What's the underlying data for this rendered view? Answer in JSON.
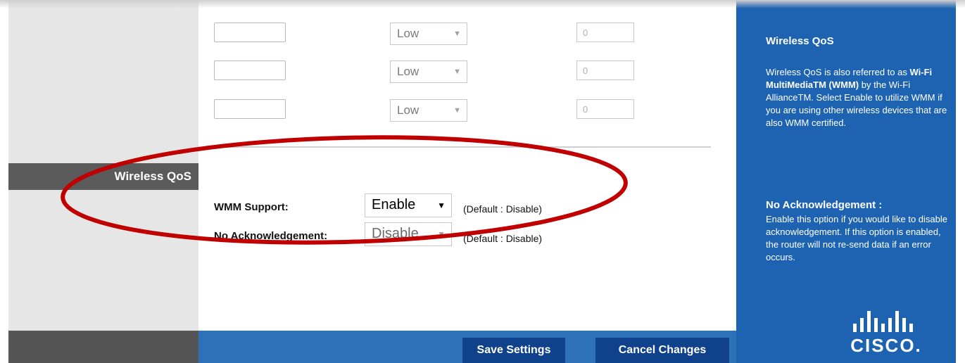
{
  "priority_rows": [
    {
      "port_value": "",
      "priority": "Low",
      "number": "0"
    },
    {
      "port_value": "",
      "priority": "Low",
      "number": "0"
    },
    {
      "port_value": "",
      "priority": "Low",
      "number": "0"
    }
  ],
  "section_label": "Wireless QoS",
  "wmm": {
    "label": "WMM Support:",
    "value": "Enable",
    "default": "(Default : Disable)"
  },
  "no_ack": {
    "label": "No Acknowledgement:",
    "value": "Disable",
    "default": "(Default : Disable)"
  },
  "buttons": {
    "save": "Save Settings",
    "cancel": "Cancel Changes"
  },
  "help": {
    "title": "Wireless QoS",
    "intro": "Wireless QoS is also referred to as",
    "wmm_name": "Wi-Fi MultiMediaTM (WMM)",
    "intro_rest": "by the Wi-Fi AllianceTM. Select Enable to utilize WMM if you are using other wireless devices that are also WMM certified.",
    "no_ack_title": "No Acknowledgement :",
    "no_ack_text": "Enable this option if you would like to disable acknowledgement. If this option is enabled, the router will not re-send data if an error occurs."
  },
  "brand": "CISCO.",
  "colors": {
    "help_panel": "#1d63b1",
    "bottom_bar": "#2d72b8",
    "button": "#10428c",
    "annotation_ellipse": "#c00000"
  },
  "icons": [
    "dropdown-arrow-icon",
    "cisco-logo",
    "annotation-ellipse"
  ]
}
